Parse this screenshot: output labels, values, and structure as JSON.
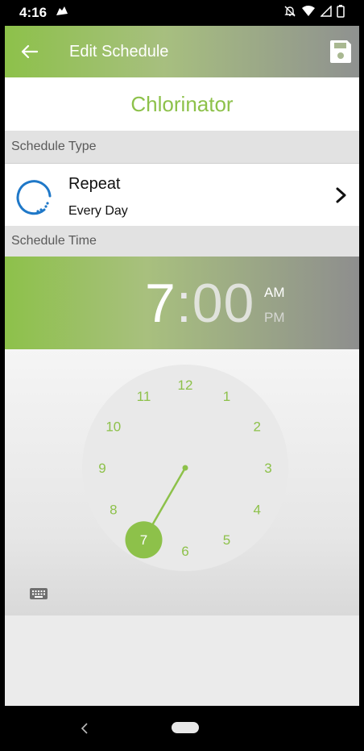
{
  "status": {
    "time": "4:16"
  },
  "appbar": {
    "title": "Edit Schedule"
  },
  "device": {
    "name": "Chlorinator"
  },
  "schedule_type": {
    "header": "Schedule Type",
    "label": "Repeat",
    "value": "Every Day"
  },
  "schedule_time": {
    "header": "Schedule Time",
    "hour": "7",
    "separator": ":",
    "minutes": "00",
    "am": "AM",
    "pm": "PM",
    "selected_period": "AM"
  },
  "dial": {
    "numbers": [
      "12",
      "1",
      "2",
      "3",
      "4",
      "5",
      "6",
      "7",
      "8",
      "9",
      "10",
      "11"
    ],
    "selected_hour": 7
  },
  "colors": {
    "accent": "#8dc14a",
    "repeat_icon": "#1f78c8"
  }
}
